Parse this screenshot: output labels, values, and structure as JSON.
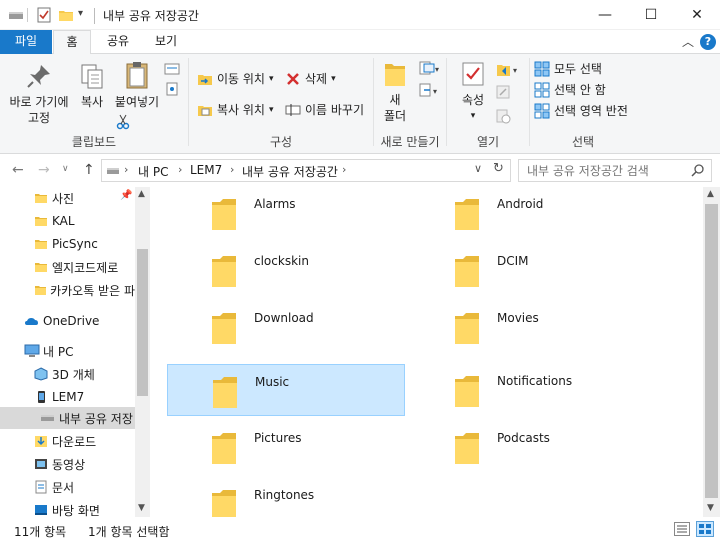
{
  "window": {
    "title": "내부 공유 저장공간",
    "minimize_icon": "—",
    "maximize_icon": "☐",
    "close_icon": "✕"
  },
  "ribbon_tabs": [
    {
      "label": "파일"
    },
    {
      "label": "홈"
    },
    {
      "label": "공유"
    },
    {
      "label": "보기"
    }
  ],
  "ribbon": {
    "clipboard": {
      "pin_label_line1": "바로 가기에",
      "pin_label_line2": "고정",
      "copy_label": "복사",
      "paste_label": "붙여넣기",
      "group_label": "클립보드"
    },
    "organize": {
      "move_to": "이동 위치",
      "copy_to": "복사 위치",
      "delete": "삭제",
      "rename": "이름 바꾸기",
      "group_label": "구성"
    },
    "new": {
      "new_folder_line1": "새",
      "new_folder_line2": "폴더",
      "group_label": "새로 만들기"
    },
    "open": {
      "properties": "속성",
      "group_label": "열기"
    },
    "select": {
      "select_all": "모두 선택",
      "select_none": "선택 안 함",
      "invert": "선택 영역 반전",
      "group_label": "선택"
    }
  },
  "address": {
    "crumbs": [
      "내 PC",
      "LEM7",
      "내부 공유 저장공간"
    ],
    "search_placeholder": "내부 공유 저장공간 검색"
  },
  "nav_items": [
    {
      "label": "사진",
      "icon": "folder-icon"
    },
    {
      "label": "KAL",
      "icon": "folder-icon"
    },
    {
      "label": "PicSync",
      "icon": "folder-icon"
    },
    {
      "label": "엘지코드제로",
      "icon": "folder-icon"
    },
    {
      "label": "카카오톡 받은 파",
      "icon": "folder-icon"
    },
    {
      "label": "OneDrive",
      "icon": "cloud-icon"
    },
    {
      "label": "내 PC",
      "icon": "computer-icon"
    },
    {
      "label": "3D 개체",
      "icon": "cube-icon"
    },
    {
      "label": "LEM7",
      "icon": "phone-icon"
    },
    {
      "label": "내부 공유 저장",
      "icon": "drive-icon"
    },
    {
      "label": "다운로드",
      "icon": "download-icon"
    },
    {
      "label": "동영상",
      "icon": "video-icon"
    },
    {
      "label": "문서",
      "icon": "document-icon"
    },
    {
      "label": "바탕 화면",
      "icon": "desktop-icon"
    }
  ],
  "folders": [
    {
      "name": "Alarms"
    },
    {
      "name": "Android"
    },
    {
      "name": "clockskin"
    },
    {
      "name": "DCIM"
    },
    {
      "name": "Download"
    },
    {
      "name": "Movies"
    },
    {
      "name": "Music"
    },
    {
      "name": "Notifications"
    },
    {
      "name": "Pictures"
    },
    {
      "name": "Podcasts"
    },
    {
      "name": "Ringtones"
    }
  ],
  "selected_folder": "Music",
  "status": {
    "item_count": "11개 항목",
    "selected_count": "1개 항목 선택함"
  }
}
